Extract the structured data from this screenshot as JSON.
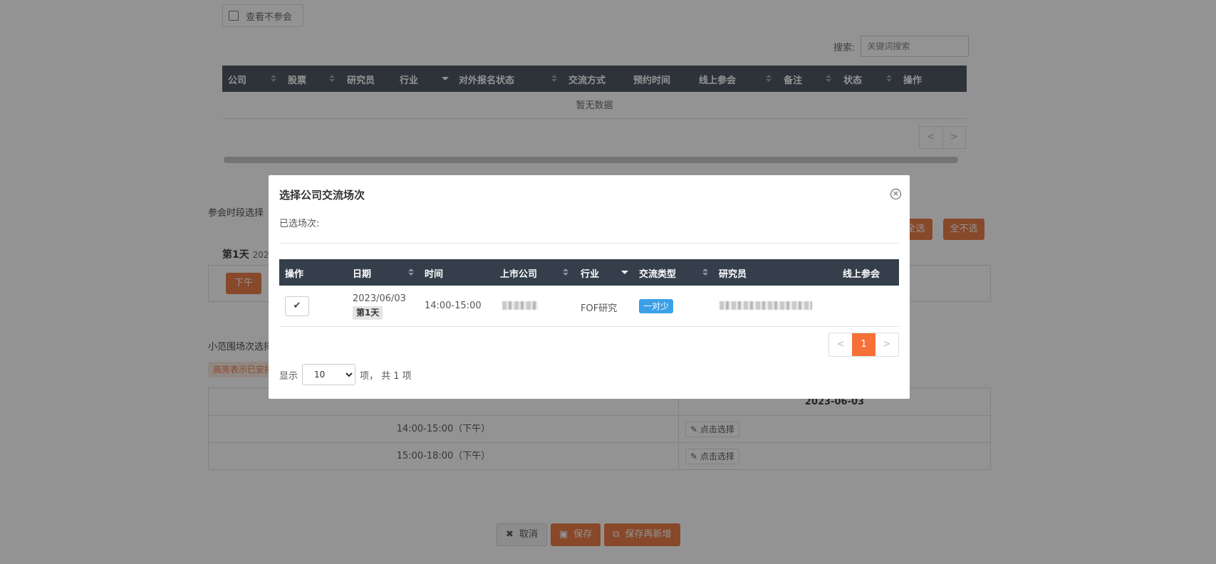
{
  "background": {
    "checkbox_label": "查看不参会",
    "search_label": "搜索:",
    "search_placeholder": "关键词搜索",
    "table_headers": [
      "公司",
      "股票",
      "研究员",
      "行业",
      "对外报名状态",
      "交流方式",
      "预约时间",
      "线上参会",
      "备注",
      "状态",
      "操作"
    ],
    "empty_text": "暂无数据",
    "pager_prev": "<",
    "pager_next": ">",
    "section_period": "参会时段选择",
    "day1_label": "第1天",
    "day1_date": "2023",
    "afternoon_btn": "下午",
    "select_all_btn": "全选",
    "deselect_all_btn": "全不选",
    "section_small": "小范围场次选择",
    "highlight_note": "高亮表示已安排",
    "schedule_date": "2023-06-03",
    "schedule_rows": [
      {
        "time": "14:00-15:00（下午）",
        "action": "点击选择"
      },
      {
        "time": "15:00-18:00（下午）",
        "action": "点击选择"
      }
    ],
    "footer": {
      "cancel": "取消",
      "save": "保存",
      "save_new": "保存再新增"
    }
  },
  "modal": {
    "title": "选择公司交流场次",
    "selected_label": "已选场次:",
    "headers": [
      "操作",
      "日期",
      "时间",
      "上市公司",
      "行业",
      "交流类型",
      "研究员",
      "线上参会"
    ],
    "rows": [
      {
        "action_icon": "check-icon",
        "date": "2023/06/03",
        "day": "第1天",
        "time": "14:00-15:00",
        "company": "",
        "industry": "FOF研究",
        "type": "一对少",
        "researcher": "",
        "online": ""
      }
    ],
    "pager": {
      "prev": "<",
      "current": "1",
      "next": ">"
    },
    "length": {
      "prefix": "显示",
      "value": "10",
      "options": [
        "10"
      ],
      "suffix": "项， 共 1 项"
    }
  },
  "colors": {
    "accent": "#e8692c",
    "header_bg": "#343f4b",
    "badge_blue": "#3aa0e8",
    "page_active": "#f57138"
  }
}
